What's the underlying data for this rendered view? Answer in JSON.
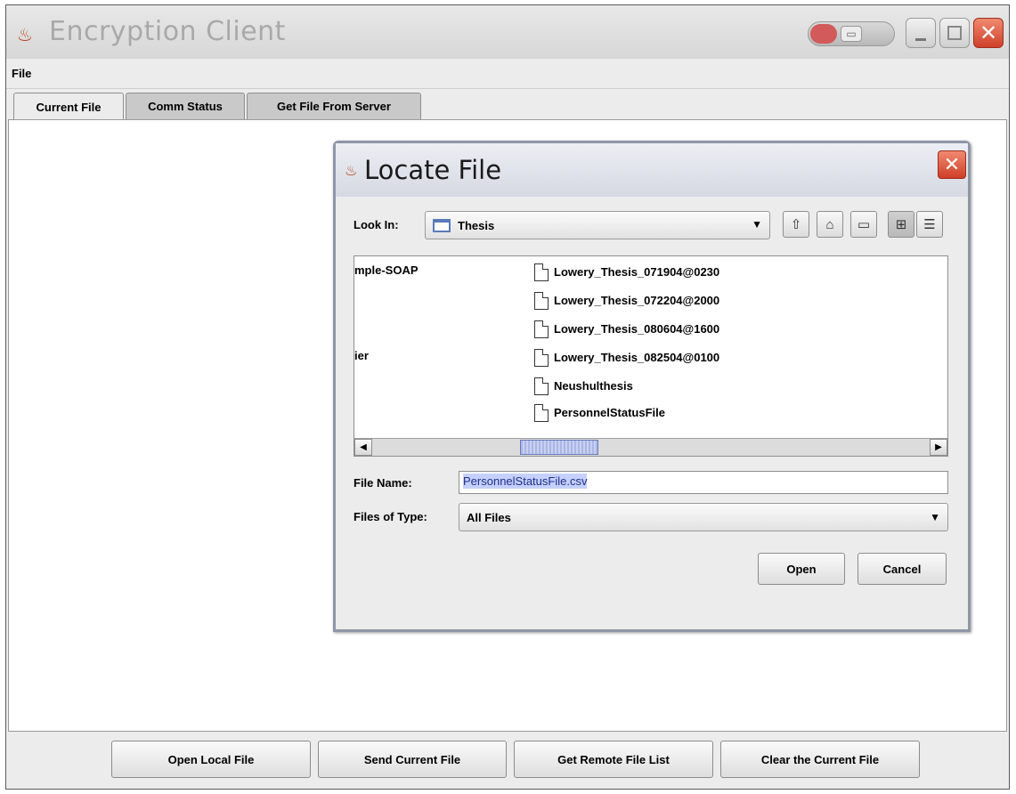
{
  "window": {
    "title": "Encryption Client",
    "title_bar_pill_label": "▭"
  },
  "menubar": {
    "file": "File"
  },
  "tabs": [
    {
      "label": "Current File",
      "active": true
    },
    {
      "label": "Comm Status",
      "active": false
    },
    {
      "label": "Get File From Server",
      "active": false
    }
  ],
  "bottom_buttons": {
    "open_local": "Open Local File",
    "send_current": "Send Current File",
    "get_remote_list": "Get Remote File List",
    "clear_current": "Clear the Current File"
  },
  "dialog": {
    "title": "Locate File",
    "close_label": "✕",
    "look_in_label": "Look In:",
    "look_in_value": "Thesis",
    "toolbar_icons": [
      "up-one-level-icon",
      "home-icon",
      "new-folder-icon",
      "list-view-icon",
      "details-view-icon"
    ],
    "left_column": [
      "mple-SOAP",
      "ier"
    ],
    "files": [
      "Lowery_Thesis_071904@0230",
      "Lowery_Thesis_072204@2000",
      "Lowery_Thesis_080604@1600",
      "Lowery_Thesis_082504@0100",
      "Neushulthesis",
      "PersonnelStatusFile"
    ],
    "file_name_label": "File Name:",
    "file_name_value": "PersonnelStatusFile.csv",
    "files_of_type_label": "Files of Type:",
    "files_of_type_value": "All Files",
    "open_label": "Open",
    "cancel_label": "Cancel"
  },
  "colors": {
    "close_red": "#d0402a",
    "selection_blue": "#c6d0ff",
    "scroll_thumb": "#aab6e6"
  }
}
